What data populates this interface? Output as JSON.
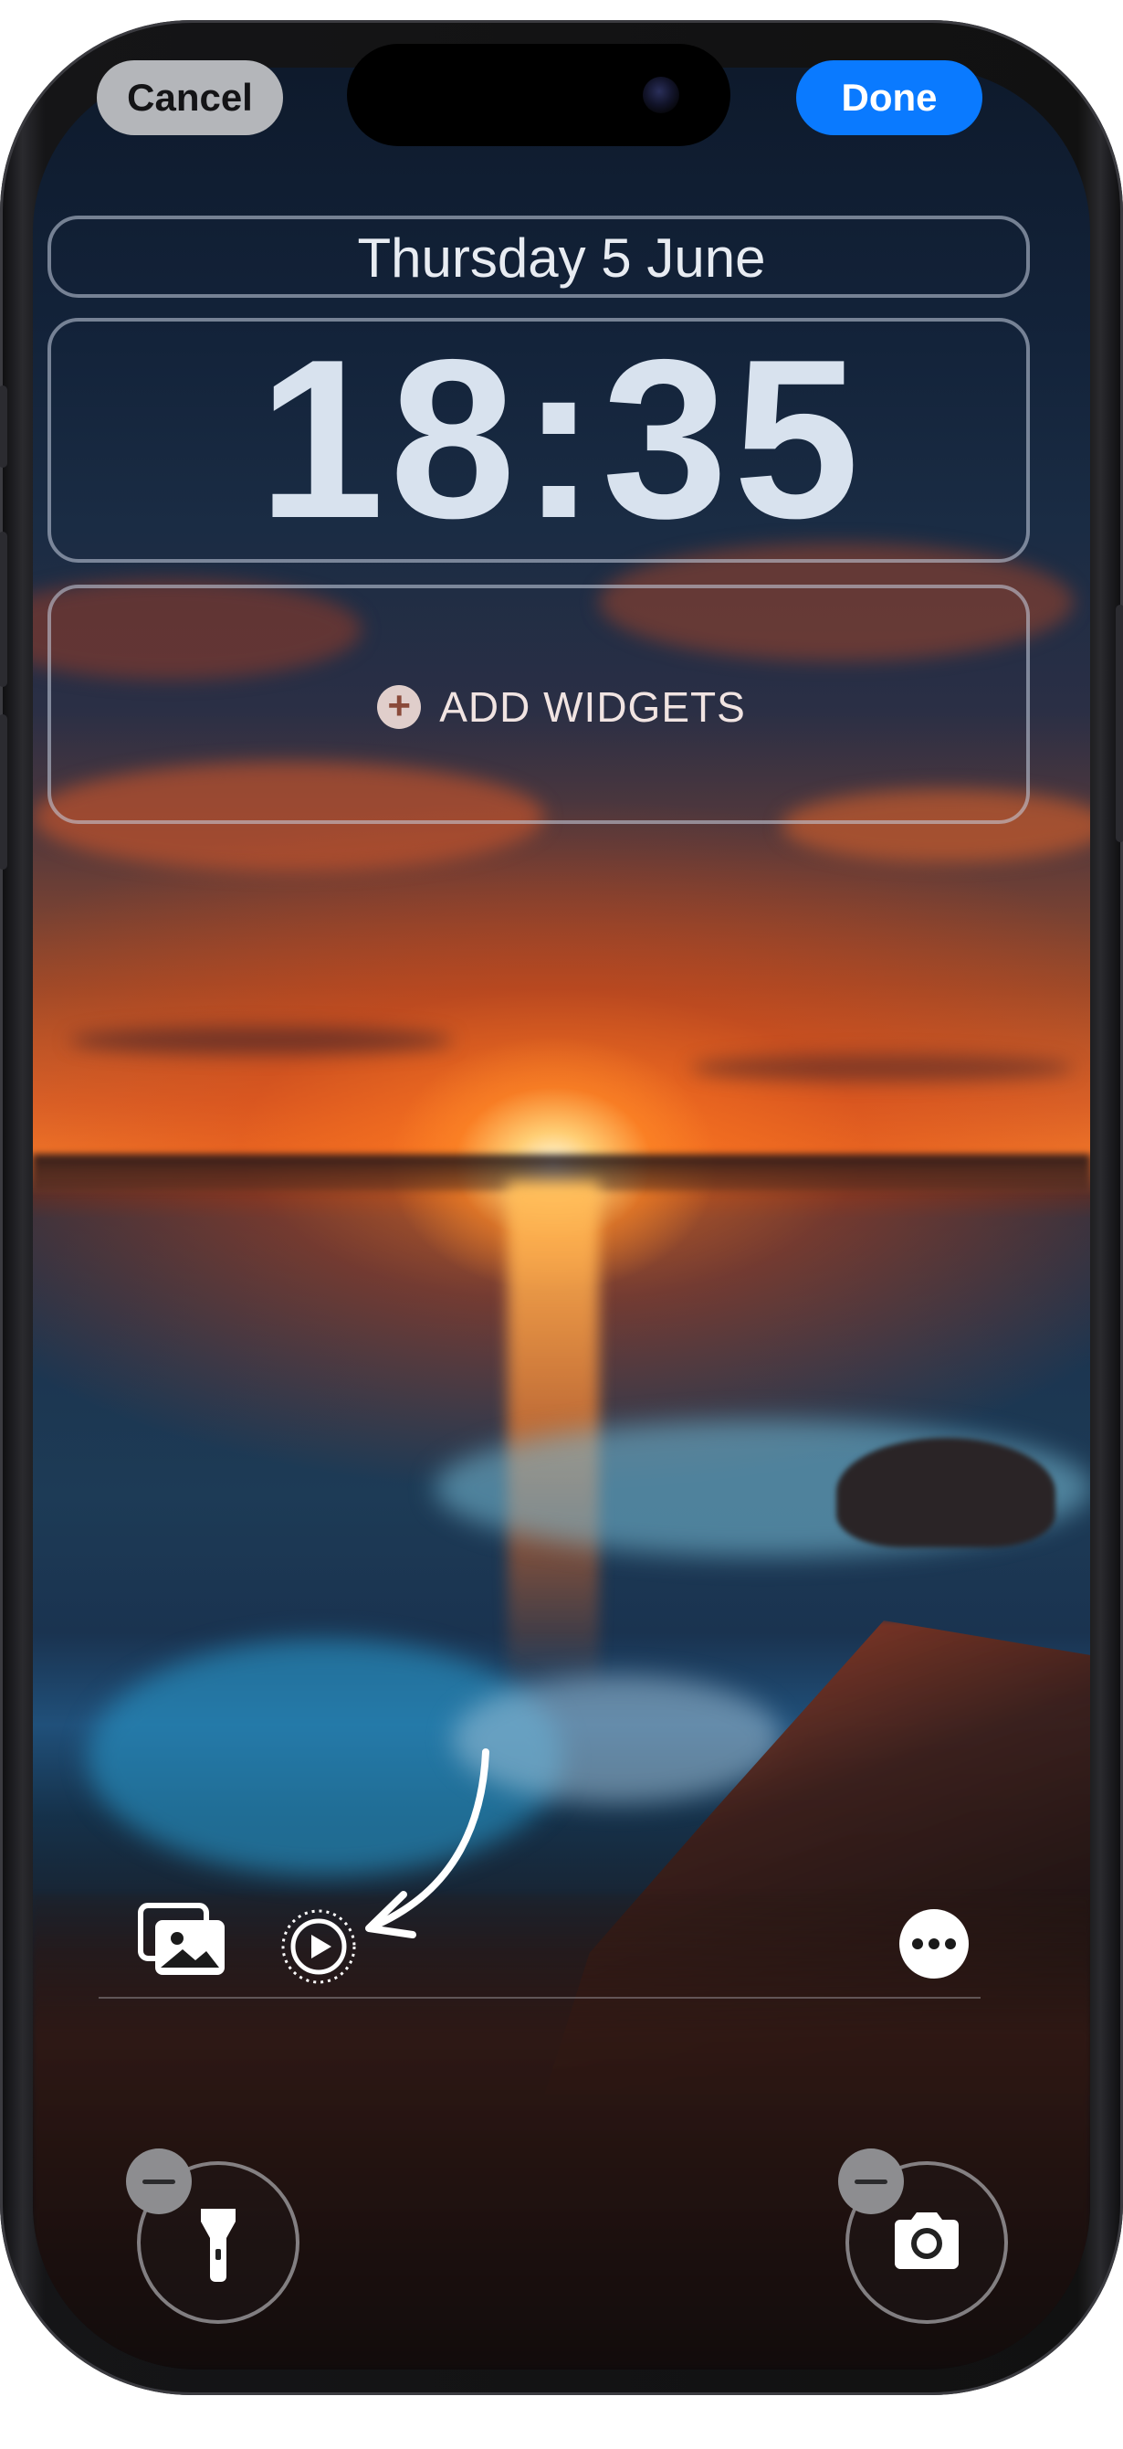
{
  "header": {
    "cancel_label": "Cancel",
    "done_label": "Done"
  },
  "lock_screen": {
    "date": "Thursday 5 June",
    "time": "18:35",
    "add_widgets_label": "ADD WIDGETS"
  },
  "controls": {
    "photos_icon": "photo-library-icon",
    "live_photo_icon": "live-photo-play-icon",
    "more_icon": "ellipsis-icon",
    "left_quick_action": "flashlight-icon",
    "right_quick_action": "camera-icon",
    "remove_icon": "minus-icon"
  },
  "colors": {
    "done_blue": "#0a7aff",
    "cancel_gray": "#b4b6ba"
  }
}
